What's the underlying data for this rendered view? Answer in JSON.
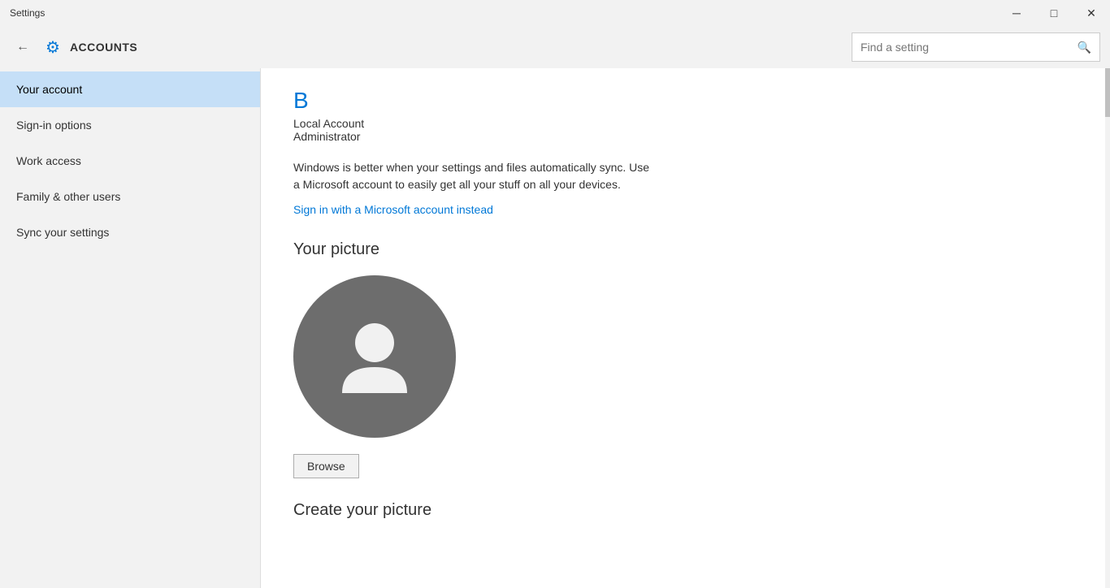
{
  "titlebar": {
    "app_name": "Settings",
    "minimize_label": "─",
    "maximize_label": "□",
    "close_label": "✕"
  },
  "header": {
    "title": "ACCOUNTS",
    "search_placeholder": "Find a setting",
    "back_label": "←",
    "gear_icon": "⚙"
  },
  "sidebar": {
    "items": [
      {
        "id": "your-account",
        "label": "Your account",
        "active": true
      },
      {
        "id": "sign-in-options",
        "label": "Sign-in options",
        "active": false
      },
      {
        "id": "work-access",
        "label": "Work access",
        "active": false
      },
      {
        "id": "family-other-users",
        "label": "Family & other users",
        "active": false
      },
      {
        "id": "sync-your-settings",
        "label": "Sync your settings",
        "active": false
      }
    ]
  },
  "content": {
    "user_letter": "B",
    "user_type": "Local Account",
    "user_role": "Administrator",
    "sync_message": "Windows is better when your settings and files automatically sync. Use a Microsoft account to easily get all your stuff on all your devices.",
    "ms_account_link": "Sign in with a Microsoft account instead",
    "your_picture_title": "Your picture",
    "browse_label": "Browse",
    "create_picture_title": "Create your picture"
  },
  "colors": {
    "accent": "#0078d7",
    "sidebar_active_bg": "#c5dff7",
    "avatar_bg": "#6d6d6d"
  }
}
